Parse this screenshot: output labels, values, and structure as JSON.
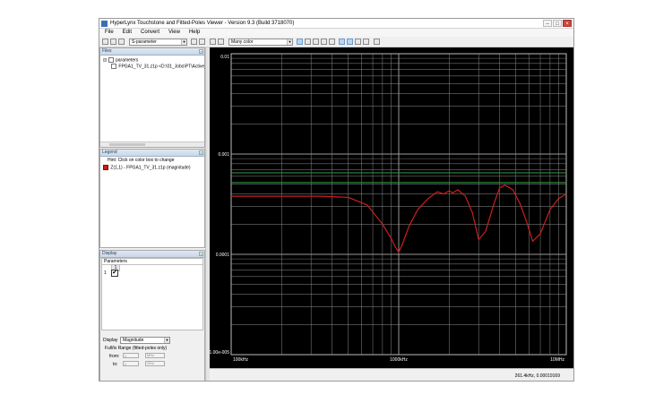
{
  "window": {
    "title": "HyperLynx Touchstone and Fitted-Poles Viewer - Version 9.3 (Build 3718070)"
  },
  "menu": [
    "File",
    "Edit",
    "Convert",
    "View",
    "Help"
  ],
  "toolbar": {
    "parameter_combo": "S-parameter",
    "color_combo": "Many color"
  },
  "files_panel": {
    "title": "Files",
    "root_label": "parameters",
    "file_label": "FPGA1_TV_31.z1p <D:\\01_Jobs\\PT\\Active_Job"
  },
  "legend_panel": {
    "title": "Legend",
    "hint": "Hint:  Click on color box to change",
    "entry_label": "Z(1,1) - FPGA1_TV_31.z1p (magnitude)",
    "entry_color": "#cc1f1f"
  },
  "display_panel": {
    "title": "Display",
    "parameters_header": "Parameters",
    "column_header": "1",
    "row_header": "1",
    "display_label": "Display",
    "display_value": "Magnitude",
    "range_label": "Full/lo Range (fitted-poles only)",
    "from_label": "from:",
    "from_value": "0",
    "from_unit": "MHz",
    "to_label": "to:",
    "to_value": "0",
    "to_unit": "GHz"
  },
  "chart_data": {
    "type": "line",
    "xscale": "log",
    "yscale": "log",
    "xlim_hz": [
      100000,
      10000000
    ],
    "ylim": [
      1e-05,
      0.01
    ],
    "x_tick_labels": [
      "100kHz",
      "1000kHz",
      "10MHz"
    ],
    "y_tick_labels": [
      "0.01",
      "0.001",
      "0.0001",
      "1.00e-005"
    ],
    "grid": true,
    "background": "#000000",
    "grid_color": "#9a9a9a",
    "band_lines": {
      "values": [
        0.00065,
        0.00052
      ],
      "color": "#2f8a3a"
    },
    "series": [
      {
        "color": "#cc1f1f",
        "x": [
          100000,
          200000,
          350000,
          500000,
          650000,
          800000,
          900000,
          950000,
          1000000,
          1050000,
          1150000,
          1300000,
          1500000,
          1700000,
          1850000,
          2000000,
          2100000,
          2250000,
          2500000,
          2750000,
          3000000,
          3300000,
          3700000,
          4000000,
          4300000,
          4800000,
          5300000,
          5800000,
          6300000,
          7000000,
          8000000,
          9000000,
          10000000
        ],
        "y": [
          0.00038,
          0.00038,
          0.00038,
          0.00037,
          0.00031,
          0.0002,
          0.000145,
          0.00012,
          0.000105,
          0.000125,
          0.00019,
          0.00028,
          0.00036,
          0.00042,
          0.0004,
          0.00043,
          0.00041,
          0.00044,
          0.00038,
          0.00026,
          0.00014,
          0.00017,
          0.00032,
          0.00046,
          0.00049,
          0.00044,
          0.00032,
          0.00021,
          0.000135,
          0.00016,
          0.00028,
          0.00036,
          0.0004
        ]
      }
    ]
  },
  "status_bar": {
    "readout": "261.4kHz, 0.00019169"
  }
}
